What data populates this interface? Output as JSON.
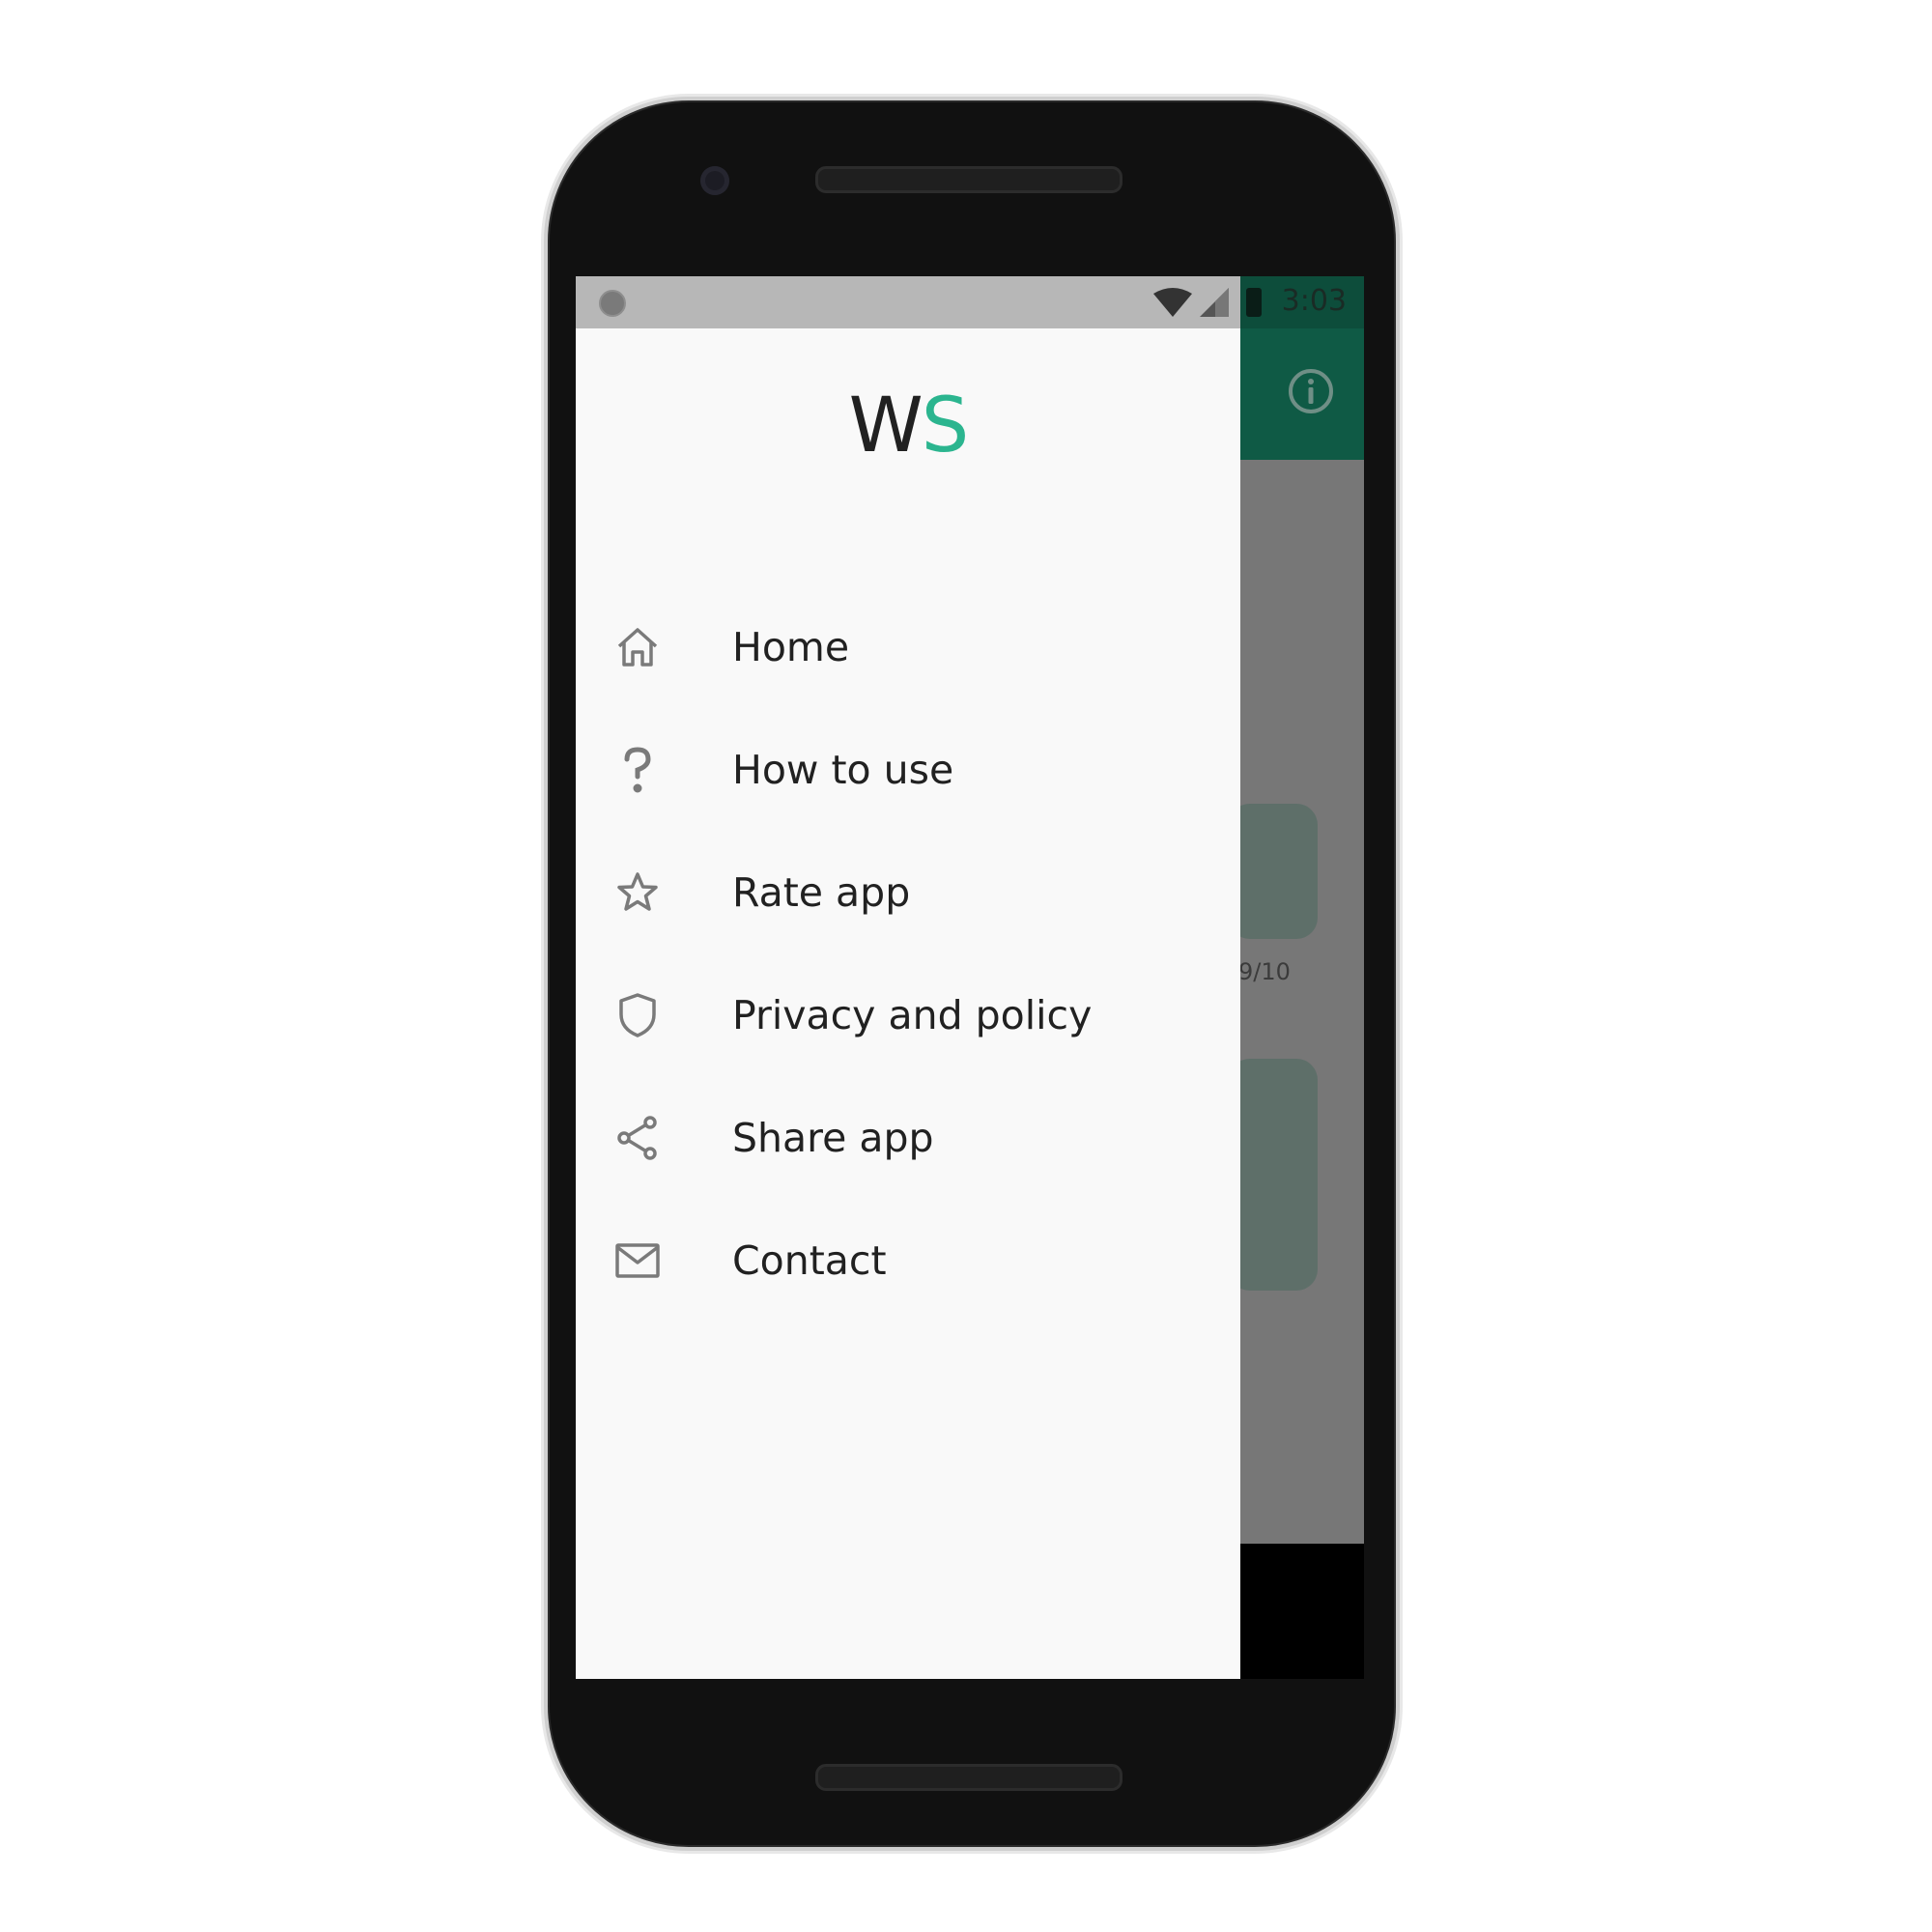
{
  "status_bar": {
    "time": "3:03"
  },
  "drawer": {
    "logo": {
      "w": "W",
      "s": "S"
    },
    "menu": [
      {
        "label": "Home",
        "icon": "home-icon"
      },
      {
        "label": "How to use",
        "icon": "question-icon"
      },
      {
        "label": "Rate app",
        "icon": "star-icon"
      },
      {
        "label": "Privacy and policy",
        "icon": "shield-icon"
      },
      {
        "label": "Share app",
        "icon": "share-icon"
      },
      {
        "label": "Contact",
        "icon": "mail-icon"
      }
    ]
  },
  "background_app": {
    "counter_fragment": "9/10"
  },
  "colors": {
    "accent": "#2bb58f",
    "toolbar": "#0f5a45",
    "icon_gray": "#7a7a7a"
  }
}
